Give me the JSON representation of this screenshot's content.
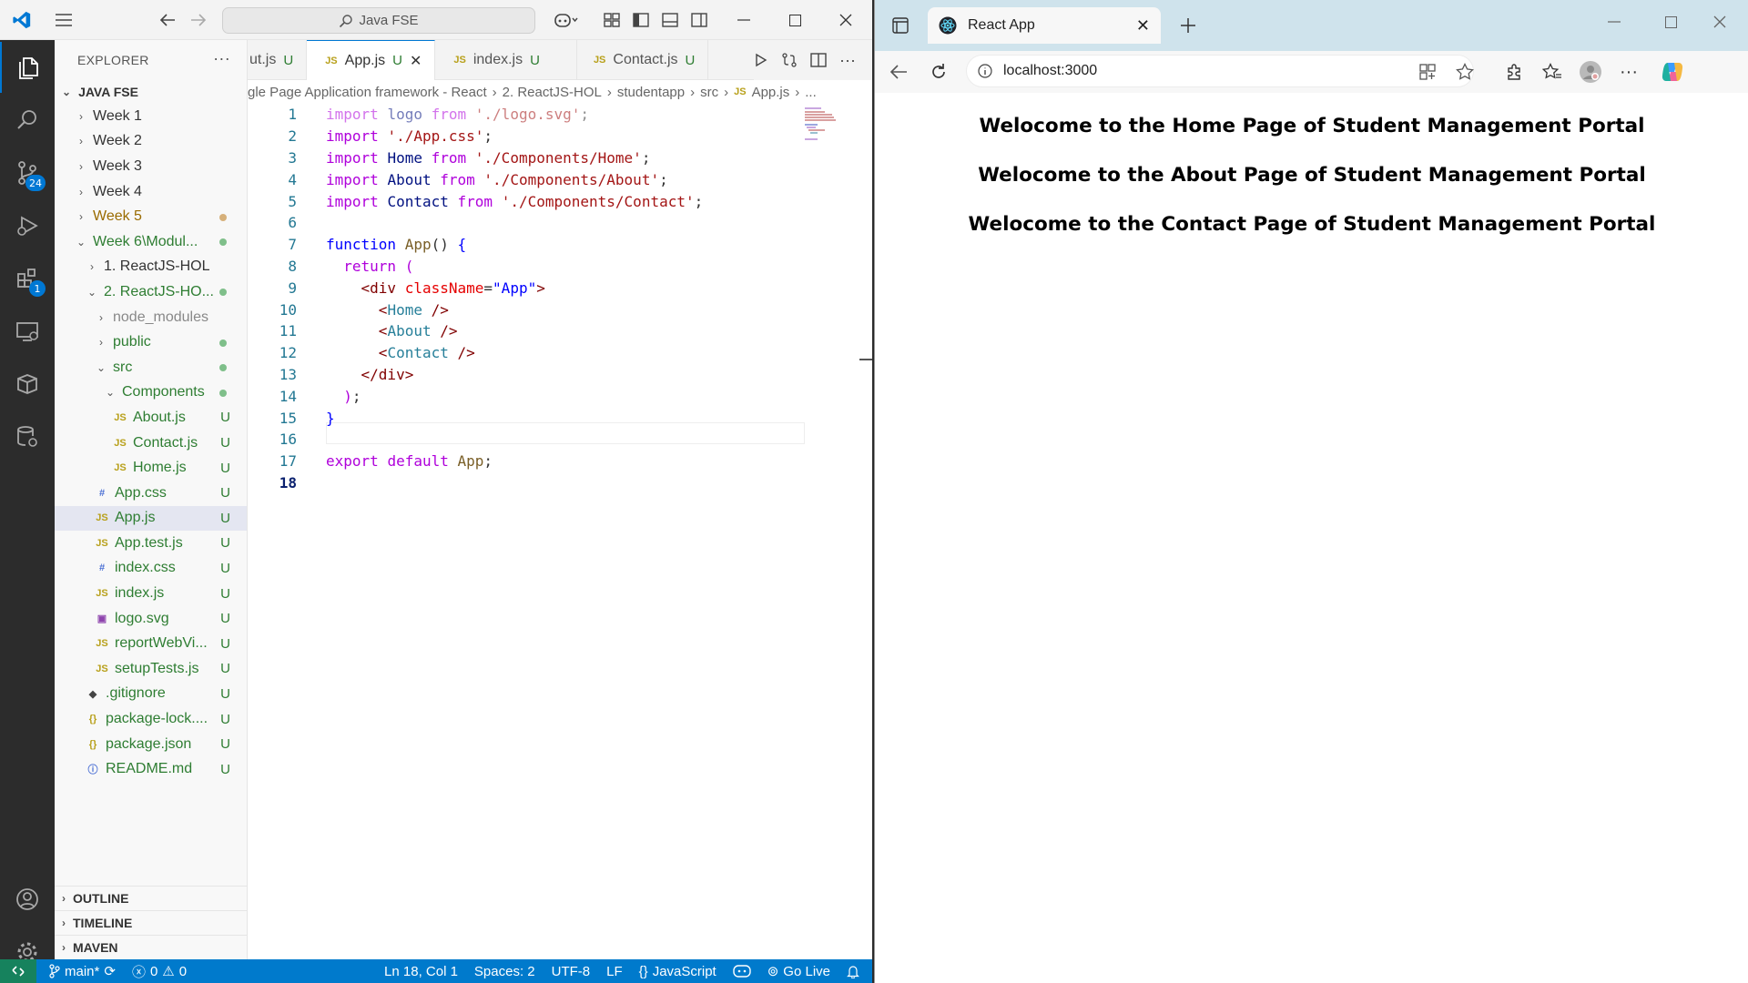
{
  "vscode": {
    "search_text": "Java FSE",
    "explorer_title": "EXPLORER",
    "explorer_more": "···",
    "workspace": "JAVA FSE",
    "badges": {
      "source_control": "24",
      "extensions": "1"
    },
    "tree": [
      {
        "label": "Week 1",
        "chev": "›",
        "icon": "",
        "decoration": ""
      },
      {
        "label": "Week 2",
        "chev": "›",
        "icon": "",
        "decoration": ""
      },
      {
        "label": "Week 3",
        "chev": "›",
        "icon": "",
        "decoration": ""
      },
      {
        "label": "Week 4",
        "chev": "›",
        "icon": "",
        "decoration": ""
      },
      {
        "label": "Week 5",
        "chev": "›",
        "icon": "",
        "decoration": "dot-orange"
      },
      {
        "label": "Week 6\\Modul...",
        "chev": "⌄",
        "icon": "",
        "decoration": "dot-green"
      },
      {
        "label": "1. ReactJS-HOL",
        "chev": "›",
        "icon": "",
        "decoration": ""
      },
      {
        "label": "2. ReactJS-HO...",
        "chev": "⌄",
        "icon": "",
        "decoration": "dot-green"
      },
      {
        "label": "node_modules",
        "chev": "›",
        "icon": "",
        "decoration": ""
      },
      {
        "label": "public",
        "chev": "›",
        "icon": "",
        "decoration": "dot-green"
      },
      {
        "label": "src",
        "chev": "⌄",
        "icon": "",
        "decoration": "dot-green"
      },
      {
        "label": "Components",
        "chev": "⌄",
        "icon": "",
        "decoration": "dot-green"
      },
      {
        "label": "About.js",
        "chev": "",
        "icon": "JS",
        "decoration": "U"
      },
      {
        "label": "Contact.js",
        "chev": "",
        "icon": "JS",
        "decoration": "U"
      },
      {
        "label": "Home.js",
        "chev": "",
        "icon": "JS",
        "decoration": "U"
      },
      {
        "label": "App.css",
        "chev": "",
        "icon": "#",
        "decoration": "U"
      },
      {
        "label": "App.js",
        "chev": "",
        "icon": "JS",
        "decoration": "U"
      },
      {
        "label": "App.test.js",
        "chev": "",
        "icon": "JS",
        "decoration": "U"
      },
      {
        "label": "index.css",
        "chev": "",
        "icon": "#",
        "decoration": "U"
      },
      {
        "label": "index.js",
        "chev": "",
        "icon": "JS",
        "decoration": "U"
      },
      {
        "label": "logo.svg",
        "chev": "",
        "icon": "▣",
        "decoration": "U"
      },
      {
        "label": "reportWebVi...",
        "chev": "",
        "icon": "JS",
        "decoration": "U"
      },
      {
        "label": "setupTests.js",
        "chev": "",
        "icon": "JS",
        "decoration": "U"
      },
      {
        "label": ".gitignore",
        "chev": "",
        "icon": "◆",
        "decoration": "U"
      },
      {
        "label": "package-lock....",
        "chev": "",
        "icon": "{}",
        "decoration": "U"
      },
      {
        "label": "package.json",
        "chev": "",
        "icon": "{}",
        "decoration": "U"
      },
      {
        "label": "README.md",
        "chev": "",
        "icon": "ⓘ",
        "decoration": "U"
      }
    ],
    "bottom_sections": [
      "OUTLINE",
      "TIMELINE",
      "MAVEN"
    ],
    "tabs": [
      {
        "label": "ut.js",
        "icon": "",
        "decoration": "U",
        "active": false
      },
      {
        "label": "App.js",
        "icon": "JS",
        "decoration": "U",
        "active": true
      },
      {
        "label": "index.js",
        "icon": "JS",
        "decoration": "U",
        "active": false
      },
      {
        "label": "Contact.js",
        "icon": "JS",
        "decoration": "U",
        "active": false
      }
    ],
    "breadcrumb": [
      "gle Page Application framework - React",
      "2. ReactJS-HOL",
      "studentapp",
      "src",
      "App.js",
      "..."
    ],
    "breadcrumb_icon": "JS",
    "code_line_numbers": [
      "1",
      "2",
      "3",
      "4",
      "5",
      "6",
      "7",
      "8",
      "9",
      "10",
      "11",
      "12",
      "13",
      "14",
      "15",
      "16",
      "17",
      "18"
    ],
    "status": {
      "branch": "main*",
      "errors": "0",
      "warnings": "0",
      "position": "Ln 18, Col 1",
      "spaces": "Spaces: 2",
      "encoding": "UTF-8",
      "eol": "LF",
      "language": "JavaScript",
      "language_braces": "{}",
      "golive": "Go Live"
    }
  },
  "edge": {
    "tab_title": "React App",
    "url": "localhost:3000",
    "headings": [
      "Welocome to the Home Page of Student Management Portal",
      "Welocome to the About Page of Student Management Portal",
      "Welocome to the Contact Page of Student Management Portal"
    ]
  },
  "colors": {
    "vscode_accent": "#007acc",
    "git_untracked": "#2e7d32",
    "edge_tabbar": "#cfe3ec"
  }
}
